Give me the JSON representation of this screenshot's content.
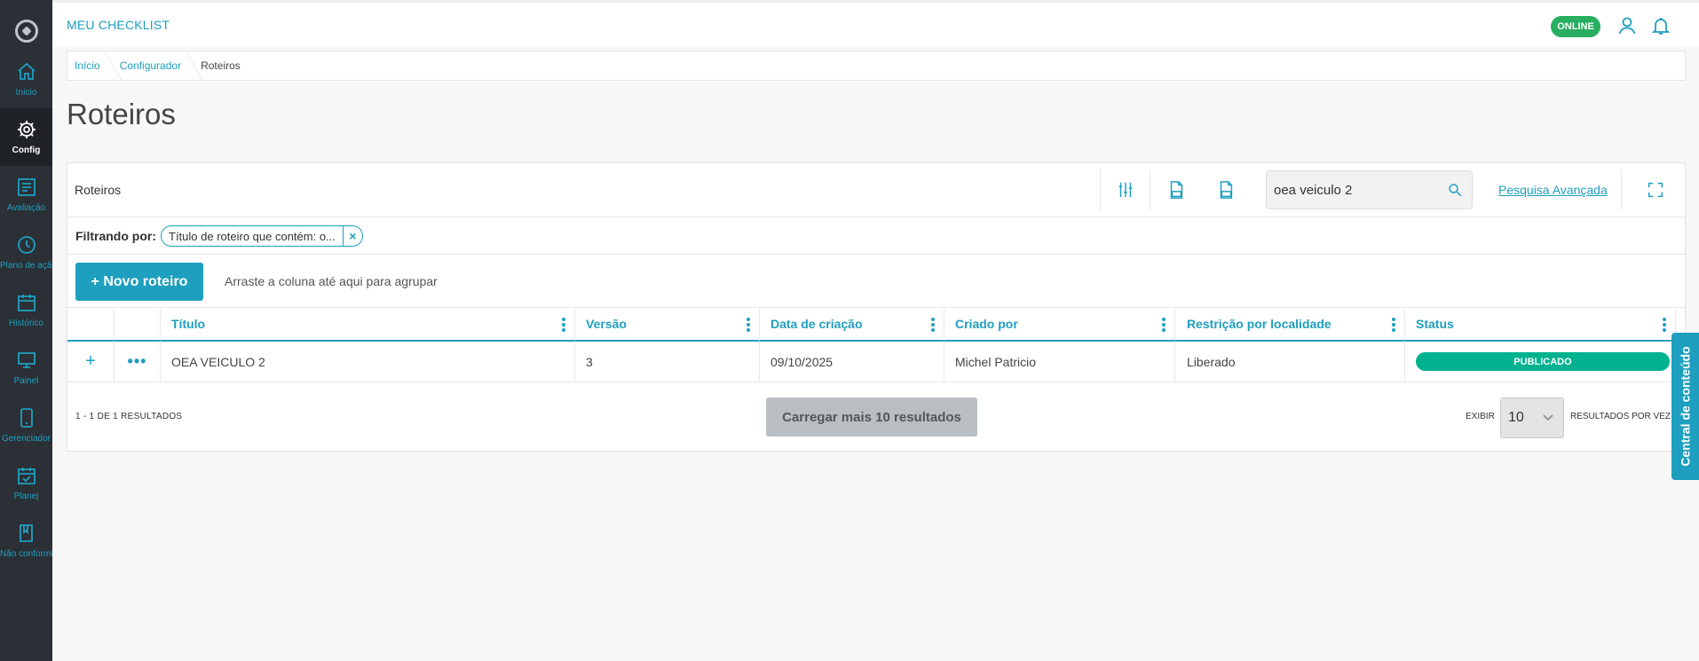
{
  "app": {
    "title": "MEU CHECKLIST",
    "status": "ONLINE"
  },
  "sidebar": {
    "items": [
      {
        "label": "Início",
        "icon": "home-icon"
      },
      {
        "label": "Config",
        "icon": "gear-icon",
        "active": true
      },
      {
        "label": "Avaliação",
        "icon": "evaluation-icon"
      },
      {
        "label": "Plano de ação",
        "icon": "clock-icon"
      },
      {
        "label": "Histórico",
        "icon": "calendar-icon"
      },
      {
        "label": "Painel",
        "icon": "monitor-icon"
      },
      {
        "label": "Gerenciador",
        "icon": "mobile-icon"
      },
      {
        "label": "Planej",
        "icon": "calendar-check-icon"
      },
      {
        "label": "Não conformidade",
        "icon": "book-icon"
      }
    ]
  },
  "breadcrumb": [
    "Início",
    "Configurador",
    "Roteiros"
  ],
  "page": {
    "title": "Roteiros"
  },
  "grid": {
    "title": "Roteiros",
    "search_value": "oea veiculo 2",
    "advanced_search": "Pesquisa Avançada",
    "filter_label": "Filtrando por:",
    "filter_chip": "Título de roteiro que contém: o...",
    "new_button": "+ Novo roteiro",
    "group_hint": "Arraste a coluna até aqui para agrupar",
    "columns": [
      "Título",
      "Versão",
      "Data de criação",
      "Criado por",
      "Restrição por localidade",
      "Status"
    ],
    "rows": [
      {
        "titulo": "OEA VEICULO 2",
        "versao": "3",
        "data": "09/10/2025",
        "criado_por": "Michel Patricio",
        "restricao": "Liberado",
        "status": "PUBLICADO"
      }
    ],
    "result_count": "1 - 1 DE 1 RESULTADOS",
    "load_more": "Carregar mais 10 resultados",
    "show_label": "EXIBIR",
    "page_size": "10",
    "per_page_label": "RESULTADOS POR VEZ"
  },
  "side_tab": "Central de conteúdo",
  "colors": {
    "accent": "#1e9fbf",
    "sidebar": "#2b3036",
    "online": "#27ae60",
    "published": "#00b28f"
  }
}
